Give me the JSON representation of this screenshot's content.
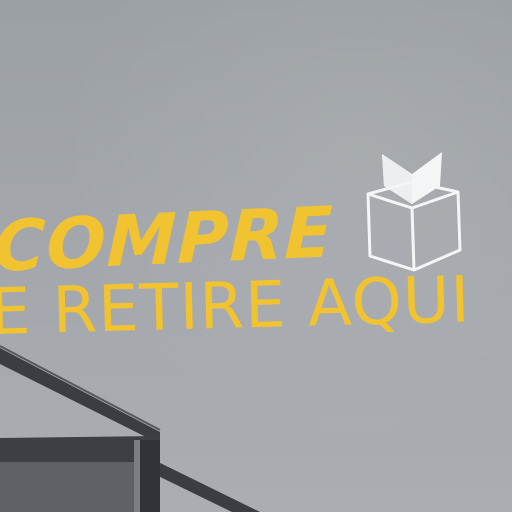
{
  "sign": {
    "line1": "COMPRE",
    "line2": "E RETIRE AQUI"
  },
  "colors": {
    "wall": "#a3a7ab",
    "text": "#f2c330",
    "icon": "#f4f5f6",
    "railing": "#3c3f44"
  },
  "icons": {
    "box": "open-box-icon"
  }
}
